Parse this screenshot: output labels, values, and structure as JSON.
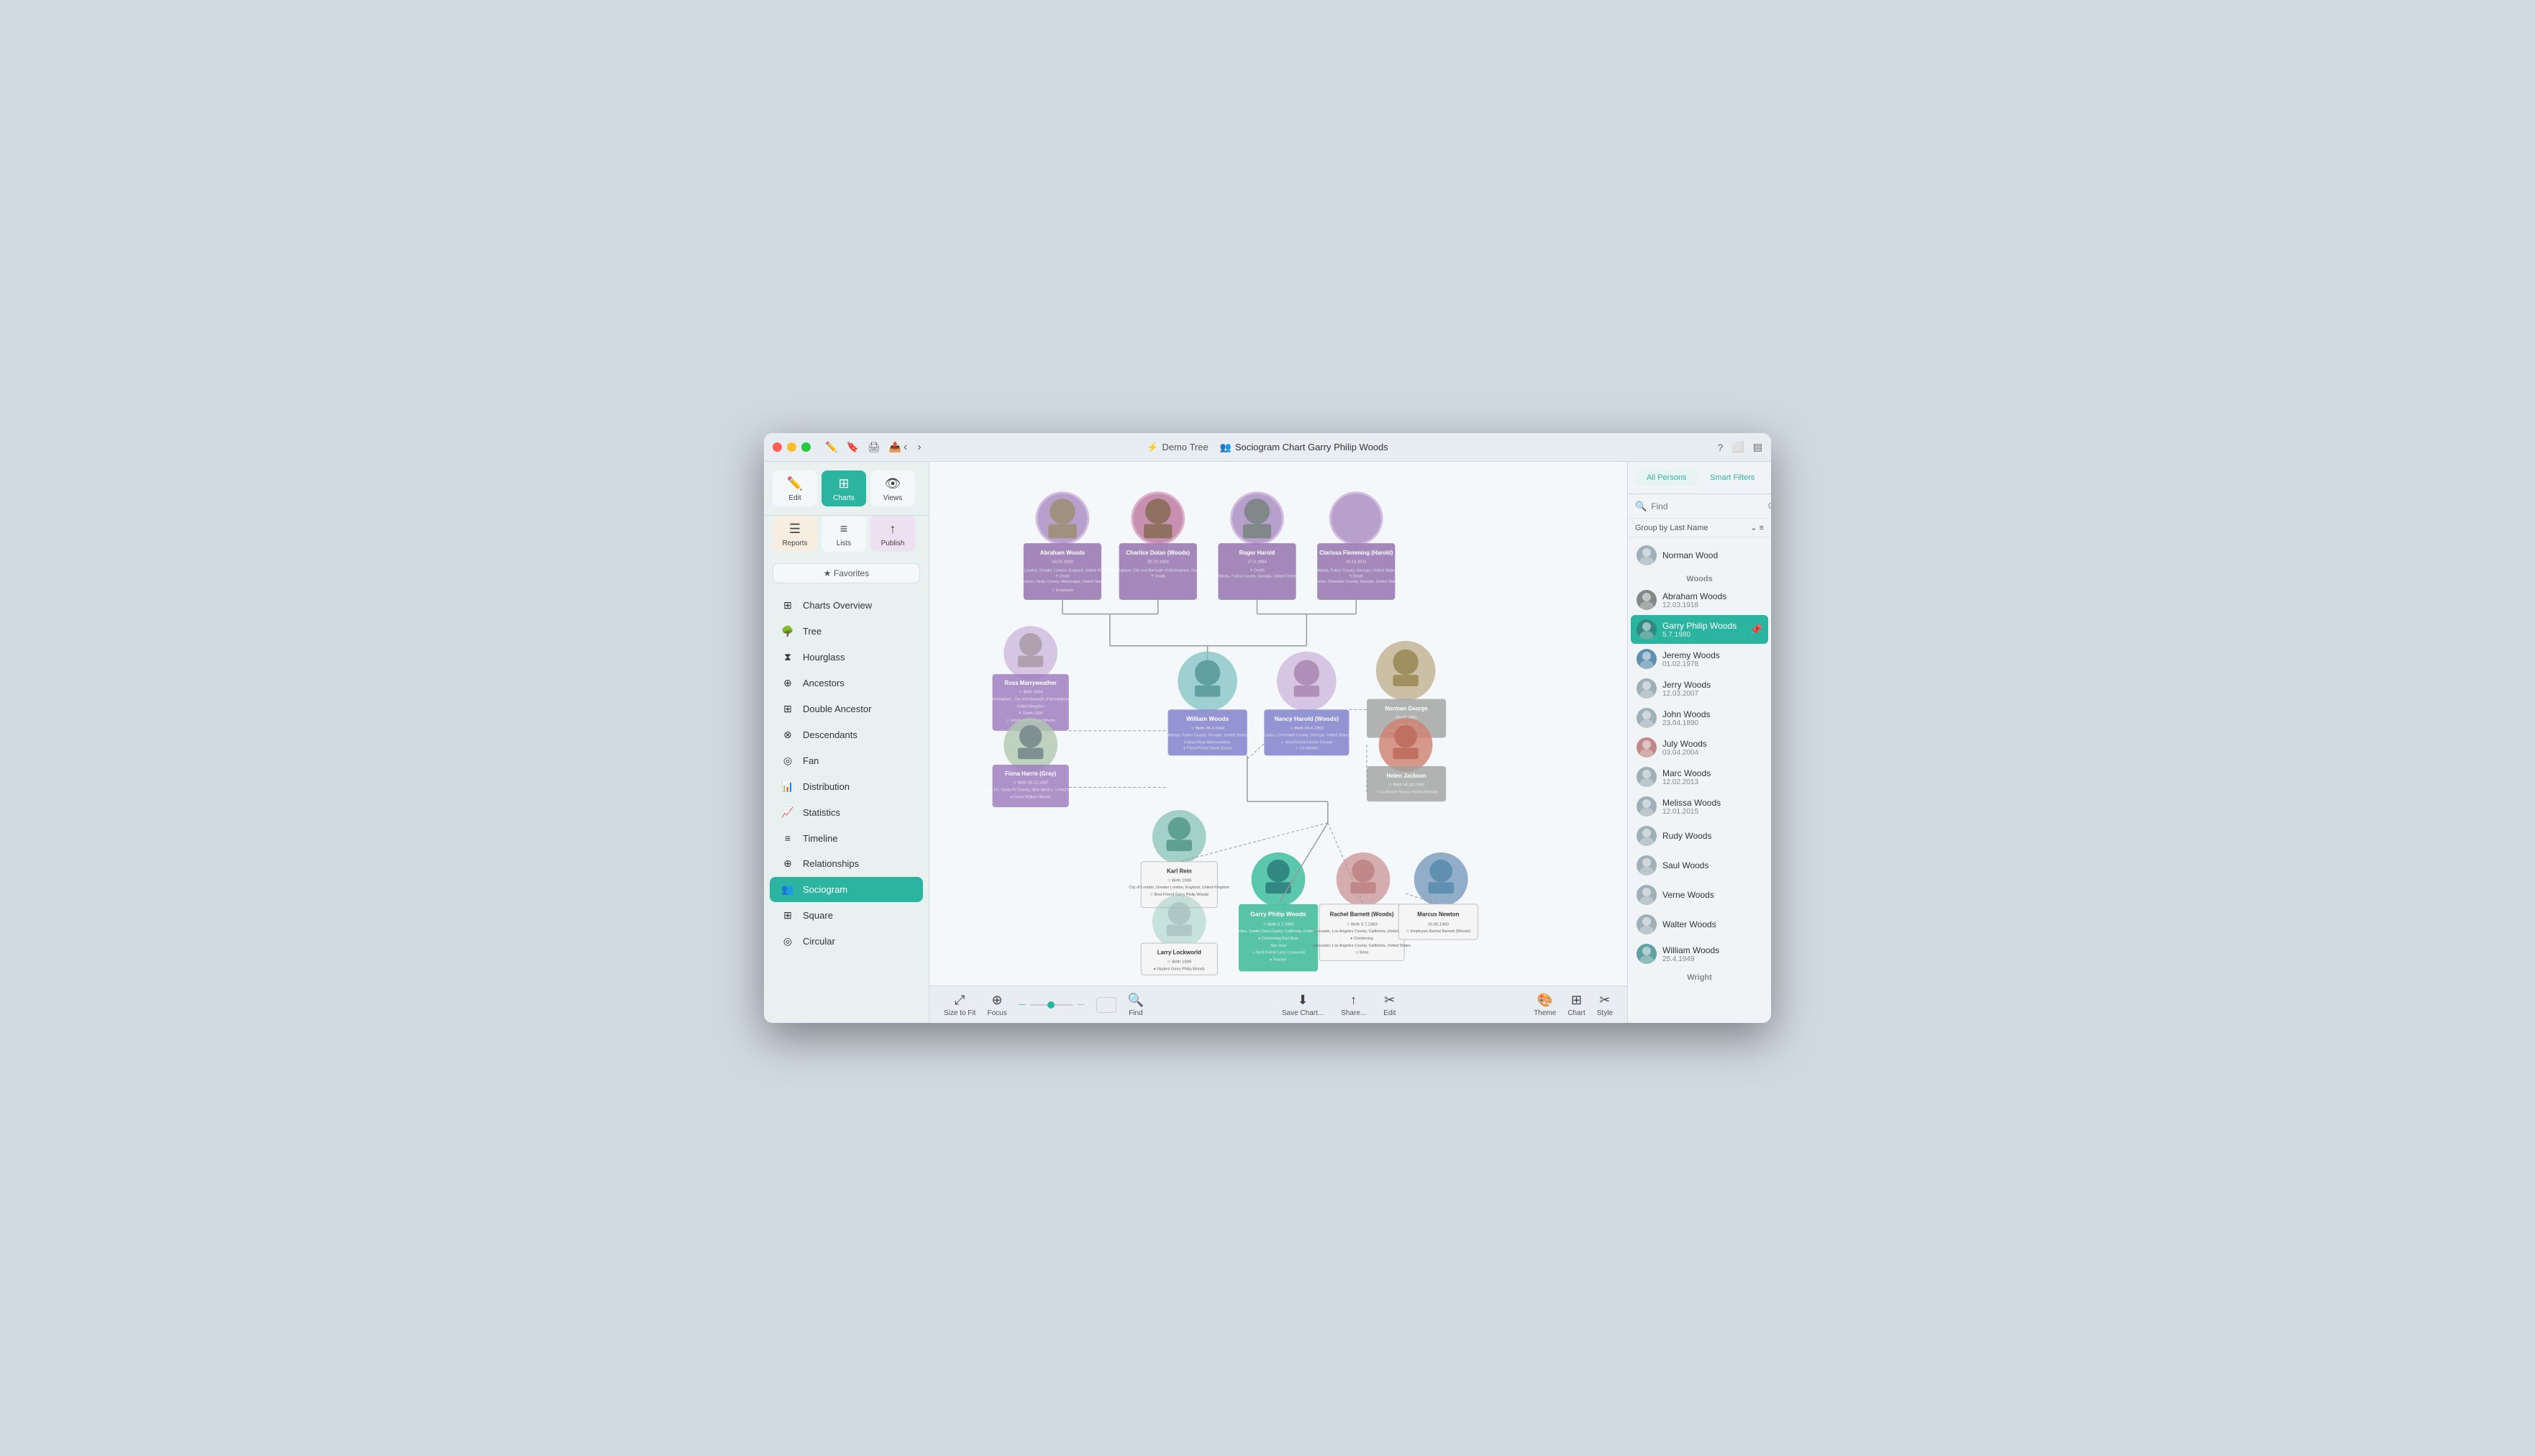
{
  "window": {
    "title": "Demo Tree — Sociogram Chart Garry Philip Woods"
  },
  "titlebar": {
    "tree_icon": "⚡",
    "tree_label": "Demo Tree",
    "chart_icon": "👥",
    "chart_label": "Sociogram Chart Garry Philip Woods"
  },
  "toolbar": {
    "edit_label": "Edit",
    "charts_label": "Charts",
    "views_label": "Views",
    "reports_label": "Reports",
    "lists_label": "Lists",
    "publish_label": "Publish",
    "favorites_label": "★ Favorites"
  },
  "sidebar_nav": [
    {
      "id": "charts-overview",
      "label": "Charts Overview",
      "icon": "grid"
    },
    {
      "id": "tree",
      "label": "Tree",
      "icon": "tree"
    },
    {
      "id": "hourglass",
      "label": "Hourglass",
      "icon": "hourglass"
    },
    {
      "id": "ancestors",
      "label": "Ancestors",
      "icon": "ancestors"
    },
    {
      "id": "double-ancestor",
      "label": "Double Ancestor",
      "icon": "double"
    },
    {
      "id": "descendants",
      "label": "Descendants",
      "icon": "descendants"
    },
    {
      "id": "fan",
      "label": "Fan",
      "icon": "fan"
    },
    {
      "id": "distribution",
      "label": "Distribution",
      "icon": "distribution"
    },
    {
      "id": "statistics",
      "label": "Statistics",
      "icon": "statistics"
    },
    {
      "id": "timeline",
      "label": "Timeline",
      "icon": "timeline"
    },
    {
      "id": "relationships",
      "label": "Relationships",
      "icon": "relationships"
    },
    {
      "id": "sociogram",
      "label": "Sociogram",
      "icon": "sociogram",
      "active": true
    },
    {
      "id": "square",
      "label": "Square",
      "icon": "square"
    },
    {
      "id": "circular",
      "label": "Circular",
      "icon": "circular"
    }
  ],
  "bottom_toolbar": {
    "size_to_fit": "Size to Fit",
    "focus": "Focus",
    "find": "Find",
    "save_chart": "Save Chart...",
    "share": "Share...",
    "edit": "Edit",
    "theme": "Theme",
    "chart": "Chart",
    "style": "Style"
  },
  "right_sidebar": {
    "all_persons_label": "All Persons",
    "smart_filters_label": "Smart Filters",
    "search_placeholder": "Find",
    "group_by": "Group by Last Name",
    "settings_icon": "⚙",
    "groups": [
      {
        "label": "Woods",
        "persons": [
          {
            "name": "Abraham Woods",
            "date": "12.03.1918",
            "has_photo": true,
            "active": false
          },
          {
            "name": "Garry Philip Woods",
            "date": "5.7.1980",
            "has_photo": true,
            "active": true,
            "pin": true
          },
          {
            "name": "Jeremy Woods",
            "date": "01.02.1978",
            "has_photo": true,
            "active": false
          },
          {
            "name": "Jerry Woods",
            "date": "12.03.2007",
            "has_photo": false,
            "active": false
          },
          {
            "name": "John Woods",
            "date": "23.04.1890",
            "has_photo": false,
            "active": false
          },
          {
            "name": "July Woods",
            "date": "03.04.2004",
            "has_photo": true,
            "active": false
          },
          {
            "name": "Marc Woods",
            "date": "12.02.2013",
            "has_photo": false,
            "active": false
          },
          {
            "name": "Melissa Woods",
            "date": "12.01.2015",
            "has_photo": false,
            "active": false
          },
          {
            "name": "Norman Wood",
            "date": "",
            "has_photo": false,
            "active": false
          },
          {
            "name": "Rudy Woods",
            "date": "",
            "has_photo": false,
            "active": false
          },
          {
            "name": "Saul Woods",
            "date": "",
            "has_photo": false,
            "active": false
          },
          {
            "name": "Verne Woods",
            "date": "",
            "has_photo": false,
            "active": false
          },
          {
            "name": "Walter Woods",
            "date": "",
            "has_photo": false,
            "active": false
          },
          {
            "name": "William Woods",
            "date": "25.4.1949",
            "has_photo": true,
            "active": false
          }
        ]
      },
      {
        "label": "Wright",
        "persons": []
      }
    ]
  }
}
